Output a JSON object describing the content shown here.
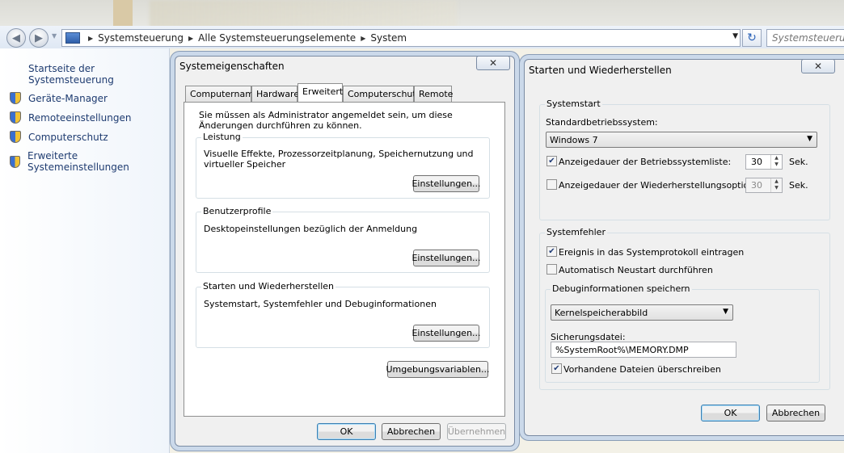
{
  "explorer": {
    "breadcrumbs": [
      "Systemsteuerung",
      "Alle Systemsteuerungselemente",
      "System"
    ],
    "search_placeholder": "Systemsteuerung"
  },
  "sidebar": {
    "home_link": "Startseite der Systemsteuerung",
    "items": [
      {
        "label": "Geräte-Manager",
        "icon": "shield-icon"
      },
      {
        "label": "Remoteeinstellungen",
        "icon": "shield-icon"
      },
      {
        "label": "Computerschutz",
        "icon": "shield-icon"
      },
      {
        "label": "Erweiterte Systemeinstellungen",
        "icon": "shield-icon"
      }
    ]
  },
  "sysprops": {
    "title": "Systemeigenschaften",
    "close_label": "✕",
    "tabs": [
      "Computername",
      "Hardware",
      "Erweitert",
      "Computerschutz",
      "Remote"
    ],
    "active_tab": "Erweitert",
    "admin_notice": "Sie müssen als Administrator angemeldet sein, um diese Änderungen durchführen zu können.",
    "groups": {
      "performance": {
        "label": "Leistung",
        "desc": "Visuelle Effekte, Prozessorzeitplanung, Speichernutzung und virtueller Speicher",
        "button": "Einstellungen..."
      },
      "profiles": {
        "label": "Benutzerprofile",
        "desc": "Desktopeinstellungen bezüglich der Anmeldung",
        "button": "Einstellungen..."
      },
      "startup": {
        "label": "Starten und Wiederherstellen",
        "desc": "Systemstart, Systemfehler und Debuginformationen",
        "button": "Einstellungen..."
      }
    },
    "env_button": "Umgebungsvariablen...",
    "ok": "OK",
    "cancel": "Abbrechen",
    "apply": "Übernehmen"
  },
  "startup_dialog": {
    "title": "Starten und Wiederherstellen",
    "close_label": "✕",
    "systemstart": {
      "label": "Systemstart",
      "default_os_label": "Standardbetriebssystem:",
      "default_os_value": "Windows 7",
      "os_list_label": "Anzeigedauer der Betriebssystemliste:",
      "os_list_checked": true,
      "os_list_value": "30",
      "os_list_unit": "Sek.",
      "recovery_label": "Anzeigedauer der Wiederherstellungsoptionen:",
      "recovery_checked": false,
      "recovery_value": "30",
      "recovery_unit": "Sek."
    },
    "systemfehler": {
      "label": "Systemfehler",
      "log_event_label": "Ereignis in das Systemprotokoll eintragen",
      "log_event_checked": true,
      "auto_restart_label": "Automatisch Neustart durchführen",
      "auto_restart_checked": false,
      "debug_group_label": "Debuginformationen speichern",
      "debug_type": "Kernelspeicherabbild",
      "dump_file_label": "Sicherungsdatei:",
      "dump_file_value": "%SystemRoot%\\MEMORY.DMP",
      "overwrite_label": "Vorhandene Dateien überschreiben",
      "overwrite_checked": true
    },
    "ok": "OK",
    "cancel": "Abbrechen"
  }
}
